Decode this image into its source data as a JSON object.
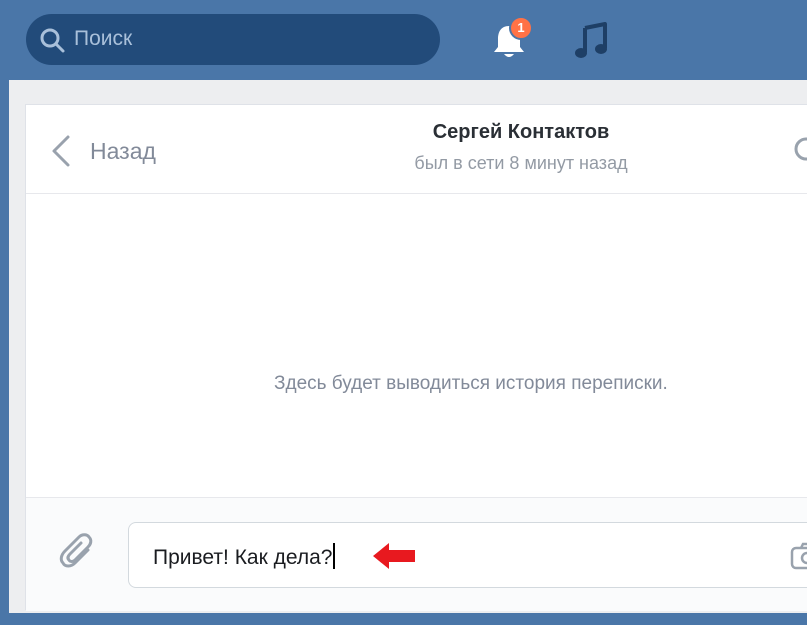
{
  "topbar": {
    "search": {
      "placeholder": "Поиск"
    },
    "notifications": {
      "badge_count": "1"
    }
  },
  "dialog": {
    "back_label": "Назад",
    "peer_name": "Сергей Контактов",
    "peer_status": "был в сети 8 минут назад",
    "empty_history": "Здесь будет выводиться история переписки.",
    "message_value": "Привет! Как дела?"
  },
  "colors": {
    "header_blue": "#4a76a8",
    "search_bg": "#224b7a",
    "badge": "#ff7246",
    "arrow_annotation": "#e8191f"
  },
  "icons": [
    "search-icon",
    "bell-icon",
    "music-icon",
    "chevron-left-icon",
    "attach-icon",
    "camera-icon",
    "arrow-annotation-icon"
  ]
}
